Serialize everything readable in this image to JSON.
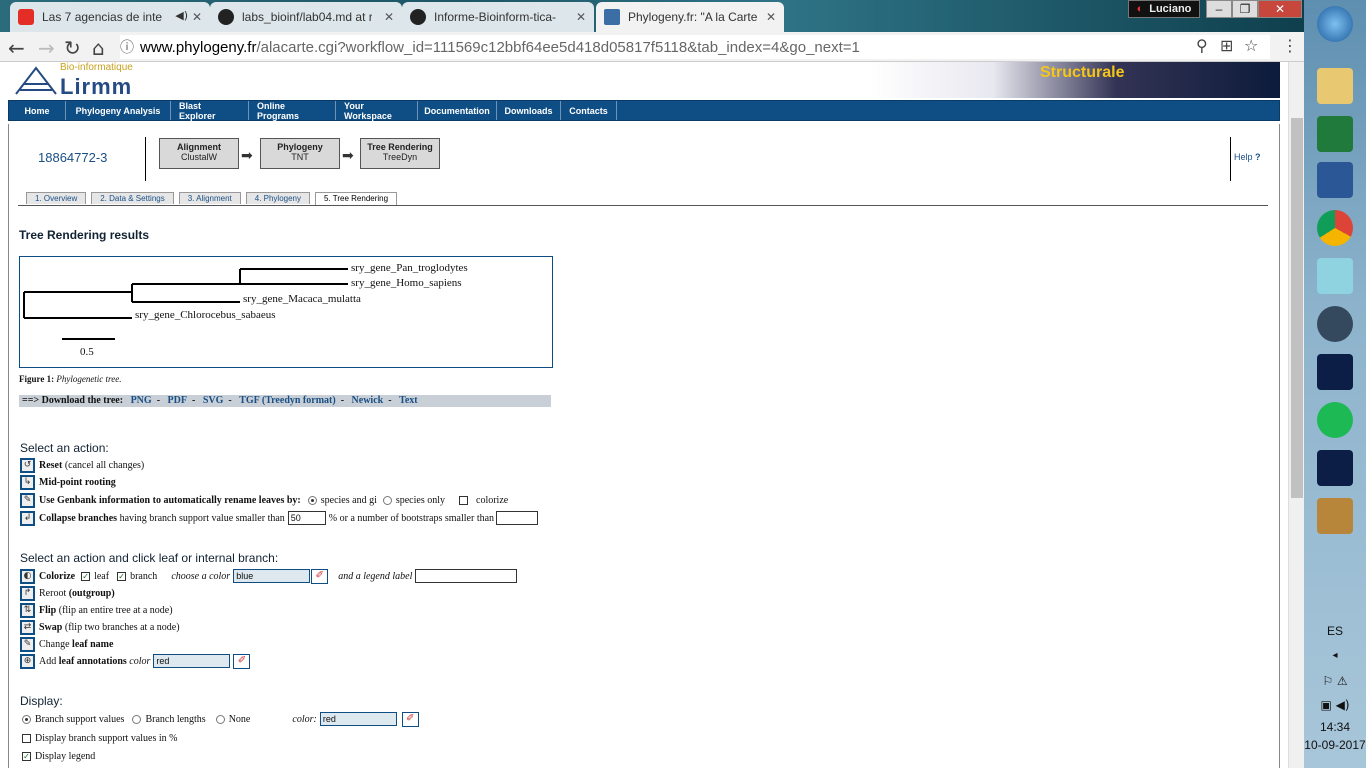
{
  "browser": {
    "tabs": [
      {
        "title": "Las 7 agencias de inte",
        "active": false
      },
      {
        "title": "labs_bioinf/lab04.md at r",
        "active": false
      },
      {
        "title": "Informe-Bioinform-tica-",
        "active": false
      },
      {
        "title": "Phylogeny.fr: \"A la Carte",
        "active": true
      }
    ],
    "user": "Luciano",
    "url_domain": "www.phylogeny.fr",
    "url_path": "/alacarte.cgi?workflow_id=111569c12bbf64ee5d418d05817f5118&tab_index=4&go_next=1"
  },
  "site": {
    "logo_text": "Lirmm",
    "logo_sub": "Bio-informatique",
    "banner_title": "Structurale",
    "menu": [
      "Home",
      "Phylogeny Analysis",
      "Blast Explorer",
      "Online Programs",
      "Your Workspace",
      "Documentation",
      "Downloads",
      "Contacts"
    ]
  },
  "workflow": {
    "id": "18864772-3",
    "steps": [
      {
        "title": "Alignment",
        "tool": "ClustalW"
      },
      {
        "title": "Phylogeny",
        "tool": "TNT"
      },
      {
        "title": "Tree Rendering",
        "tool": "TreeDyn"
      }
    ],
    "help": "Help",
    "tabs": [
      "1. Overview",
      "2. Data & Settings",
      "3. Alignment",
      "4. Phylogeny",
      "5. Tree Rendering"
    ],
    "active_tab": 4
  },
  "results": {
    "title": "Tree Rendering results",
    "leaves": [
      "sry_gene_Pan_troglodytes",
      "sry_gene_Homo_sapiens",
      "sry_gene_Macaca_mulatta",
      "sry_gene_Chlorocebus_sabaeus"
    ],
    "scale": "0.5",
    "figure_label": "Figure 1:",
    "figure_caption": "Phylogenetic tree.",
    "download_label": "==> Download the tree:",
    "downloads": [
      "PNG",
      "PDF",
      "SVG",
      "TGF (Treedyn format)",
      "Newick",
      "Text"
    ]
  },
  "actions": {
    "title": "Select an action:",
    "reset": "Reset",
    "reset_note": "(cancel all changes)",
    "midpoint": "Mid-point rooting",
    "genbank": "Use Genbank information to automatically rename leaves by:",
    "species_gi": "species and gi",
    "species_only": "species only",
    "colorize": "colorize",
    "collapse": "Collapse branches",
    "collapse_text": "having branch support value smaller than",
    "collapse_value": "50",
    "collapse_text2": "% or a number of bootstraps smaller than",
    "bootstraps_value": ""
  },
  "click_actions": {
    "title": "Select an action and click leaf or internal branch:",
    "colorize": "Colorize",
    "leaf": "leaf",
    "branch": "branch",
    "choose_color": "choose a color",
    "color_value": "blue",
    "legend_label": "and a legend label",
    "legend_value": "",
    "reroot": "Reroot",
    "reroot_note": "(outgroup)",
    "flip": "Flip",
    "flip_note": "(flip an entire tree at a node)",
    "swap": "Swap",
    "swap_note": "(flip two branches at a node)",
    "change": "Change",
    "change_bold": "leaf name",
    "add": "Add",
    "add_bold": "leaf annotations",
    "add_color": "color",
    "annot_color": "red"
  },
  "display": {
    "title": "Display:",
    "branch_support": "Branch support values",
    "branch_lengths": "Branch lengths",
    "none": "None",
    "color_label": "color:",
    "color_value": "red",
    "percent": "Display branch support values in %",
    "legend": "Display legend"
  },
  "taskbar": {
    "lang": "ES",
    "time": "14:34",
    "date": "10-09-2017"
  }
}
